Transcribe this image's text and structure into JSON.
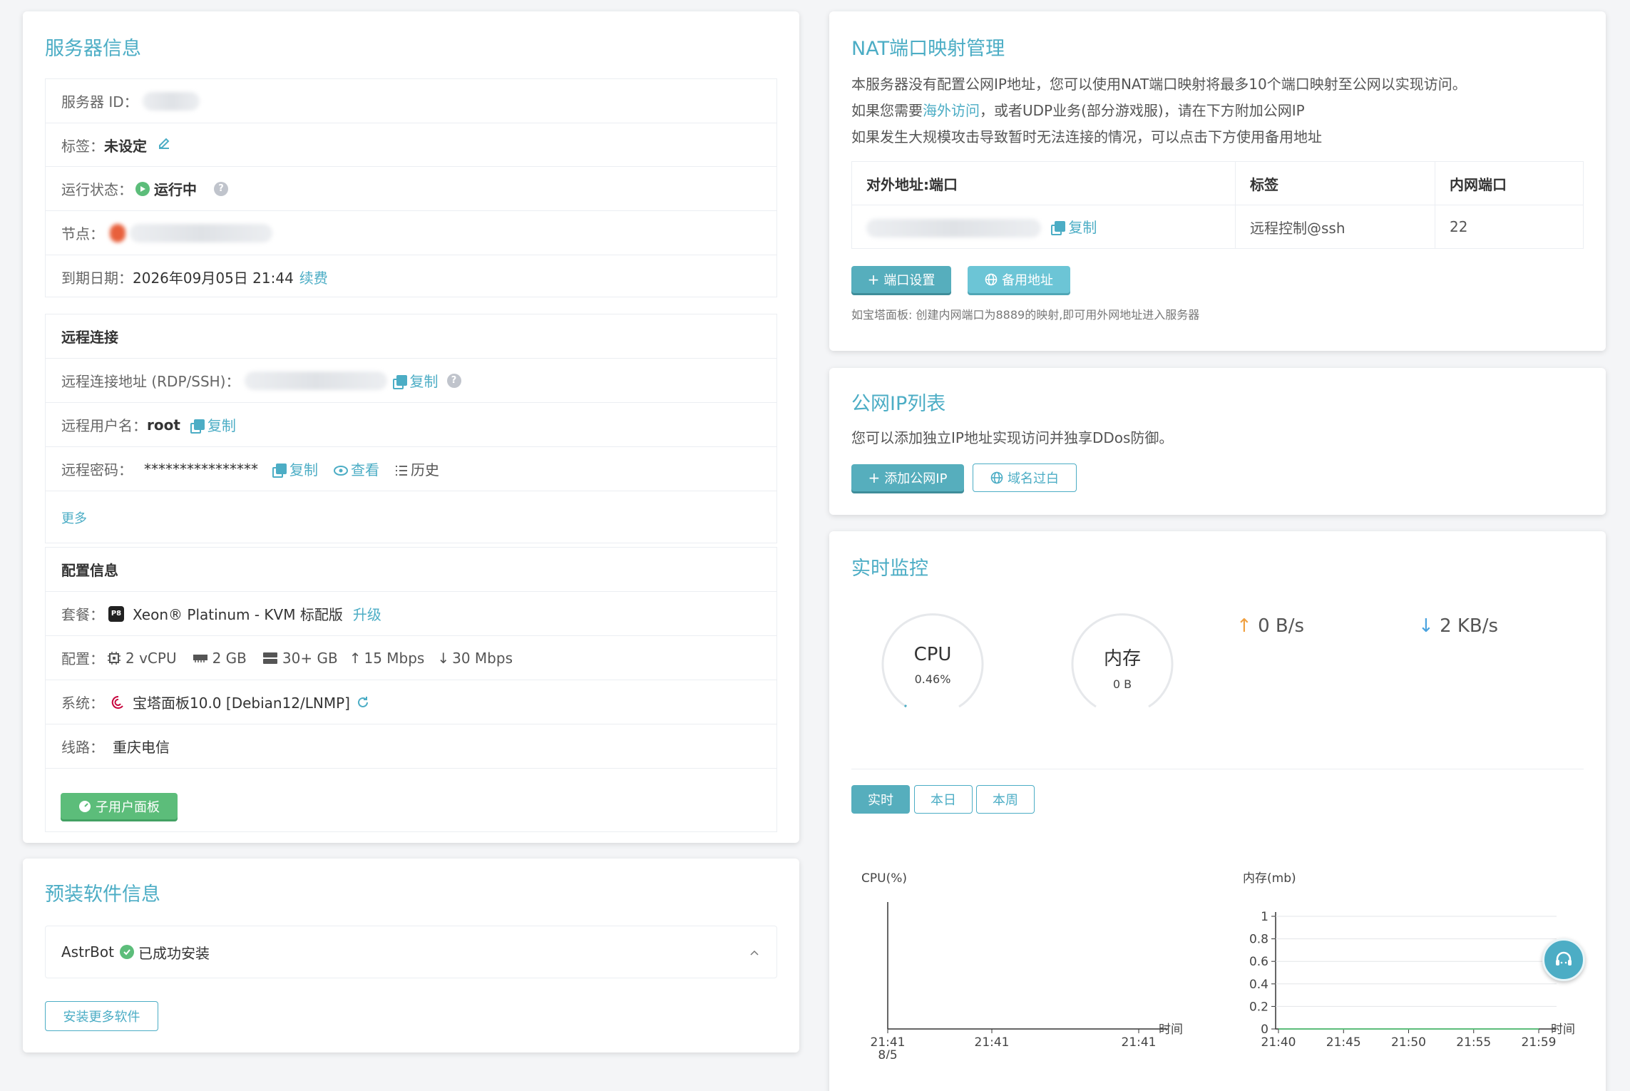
{
  "server_info": {
    "title": "服务器信息",
    "server_id_label": "服务器 ID：",
    "tag_label": "标签：",
    "tag_value": "未设定",
    "status_label": "运行状态：",
    "status_value": "运行中",
    "node_label": "节点：",
    "expiry_label": "到期日期：",
    "expiry_value": "2026年09月05日 21:44",
    "renew_link": "续费"
  },
  "remote": {
    "title": "远程连接",
    "address_label": "远程连接地址 (RDP/SSH)：",
    "copy_label": "复制",
    "user_label": "远程用户名：",
    "user_value": "root",
    "password_label": "远程密码：",
    "password_value": "****************",
    "view_label": "查看",
    "history_label": "历史",
    "more_link": "更多"
  },
  "config": {
    "title": "配置信息",
    "plan_label": "套餐：",
    "plan_badge": "P8",
    "plan_value": "Xeon® Platinum - KVM 标配版",
    "upgrade_link": "升级",
    "spec_label": "配置：",
    "cpu": "2 vCPU",
    "ram": "2 GB",
    "disk": "30+ GB",
    "up": "15 Mbps",
    "down": "30 Mbps",
    "os_label": "系统：",
    "os_value": "宝塔面板10.0 [Debian12/LNMP]",
    "line_label": "线路：",
    "line_value": "重庆电信",
    "subuser_button": "子用户面板"
  },
  "software": {
    "title": "预装软件信息",
    "item_name": "AstrBot",
    "item_status": "已成功安装",
    "install_more_button": "安装更多软件"
  },
  "nat": {
    "title": "NAT端口映射管理",
    "line1": "本服务器没有配置公网IP地址，您可以使用NAT端口映射将最多10个端口映射至公网以实现访问。",
    "line2_pre": "如果您需要",
    "line2_link": "海外访问",
    "line2_post": "，或者UDP业务(部分游戏服)，请在下方附加公网IP",
    "line3": "如果发生大规模攻击导致暂时无法连接的情况，可以点击下方使用备用地址",
    "headers": [
      "对外地址:端口",
      "标签",
      "内网端口"
    ],
    "row": {
      "copy": "复制",
      "tag": "远程控制@ssh",
      "port": "22"
    },
    "port_settings_button": "端口设置",
    "backup_address_button": "备用地址",
    "note": "如宝塔面板: 创建内网端口为8889的映射,即可用外网地址进入服务器"
  },
  "public_ip": {
    "title": "公网IP列表",
    "desc": "您可以添加独立IP地址实现访问并独享DDos防御。",
    "add_button": "添加公网IP",
    "whitelist_button": "域名过白"
  },
  "monitor": {
    "title": "实时监控",
    "cpu_gauge_title": "CPU",
    "cpu_gauge_value": "0.46%",
    "mem_gauge_title": "内存",
    "mem_gauge_value": "0 B",
    "upload_rate": "0 B/s",
    "download_rate": "2 KB/s",
    "tabs": [
      "实时",
      "本日",
      "本周"
    ]
  },
  "colors": {
    "accent": "#4cadc5",
    "green": "#5cbd7a",
    "up_arrow": "#f0a040",
    "down_arrow": "#4aa3df"
  },
  "chart_data": [
    {
      "type": "line",
      "ylabel": "CPU(%)",
      "xlabel": "时间",
      "x": [
        "21:41\n8/5",
        "21:41",
        "21:41"
      ],
      "series": [
        {
          "values": []
        }
      ]
    },
    {
      "type": "line",
      "ylabel": "内存(mb)",
      "xlabel": "时间",
      "x": [
        "21:40",
        "21:45",
        "21:50",
        "21:55",
        "21:59"
      ],
      "yticks": [
        "0",
        "0.2",
        "0.4",
        "0.6",
        "0.8",
        "1"
      ],
      "ylim": [
        0,
        1
      ],
      "series": [
        {
          "values": [
            0,
            0,
            0,
            0,
            0
          ]
        }
      ]
    }
  ]
}
